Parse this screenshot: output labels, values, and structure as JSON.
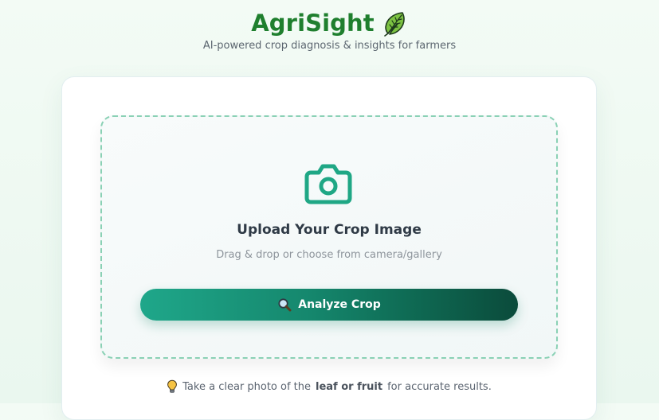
{
  "app": {
    "title": "AgriSight",
    "tagline": "AI-powered crop diagnosis & insights for farmers",
    "brand_icon": "leaf-icon",
    "accent_color": "#1f7f2e"
  },
  "upload": {
    "icon": "camera-icon",
    "title": "Upload Your Crop Image",
    "subtitle": "Drag & drop or choose from camera/gallery",
    "analyze_button": {
      "icon": "magnifier-icon",
      "label": "Analyze Crop",
      "gradient_start": "#1fa78a",
      "gradient_end": "#0b4b3b"
    }
  },
  "tip": {
    "icon": "lightbulb-icon",
    "prefix": "Take a clear photo of the",
    "highlight": "leaf or fruit",
    "suffix": "for accurate results."
  }
}
